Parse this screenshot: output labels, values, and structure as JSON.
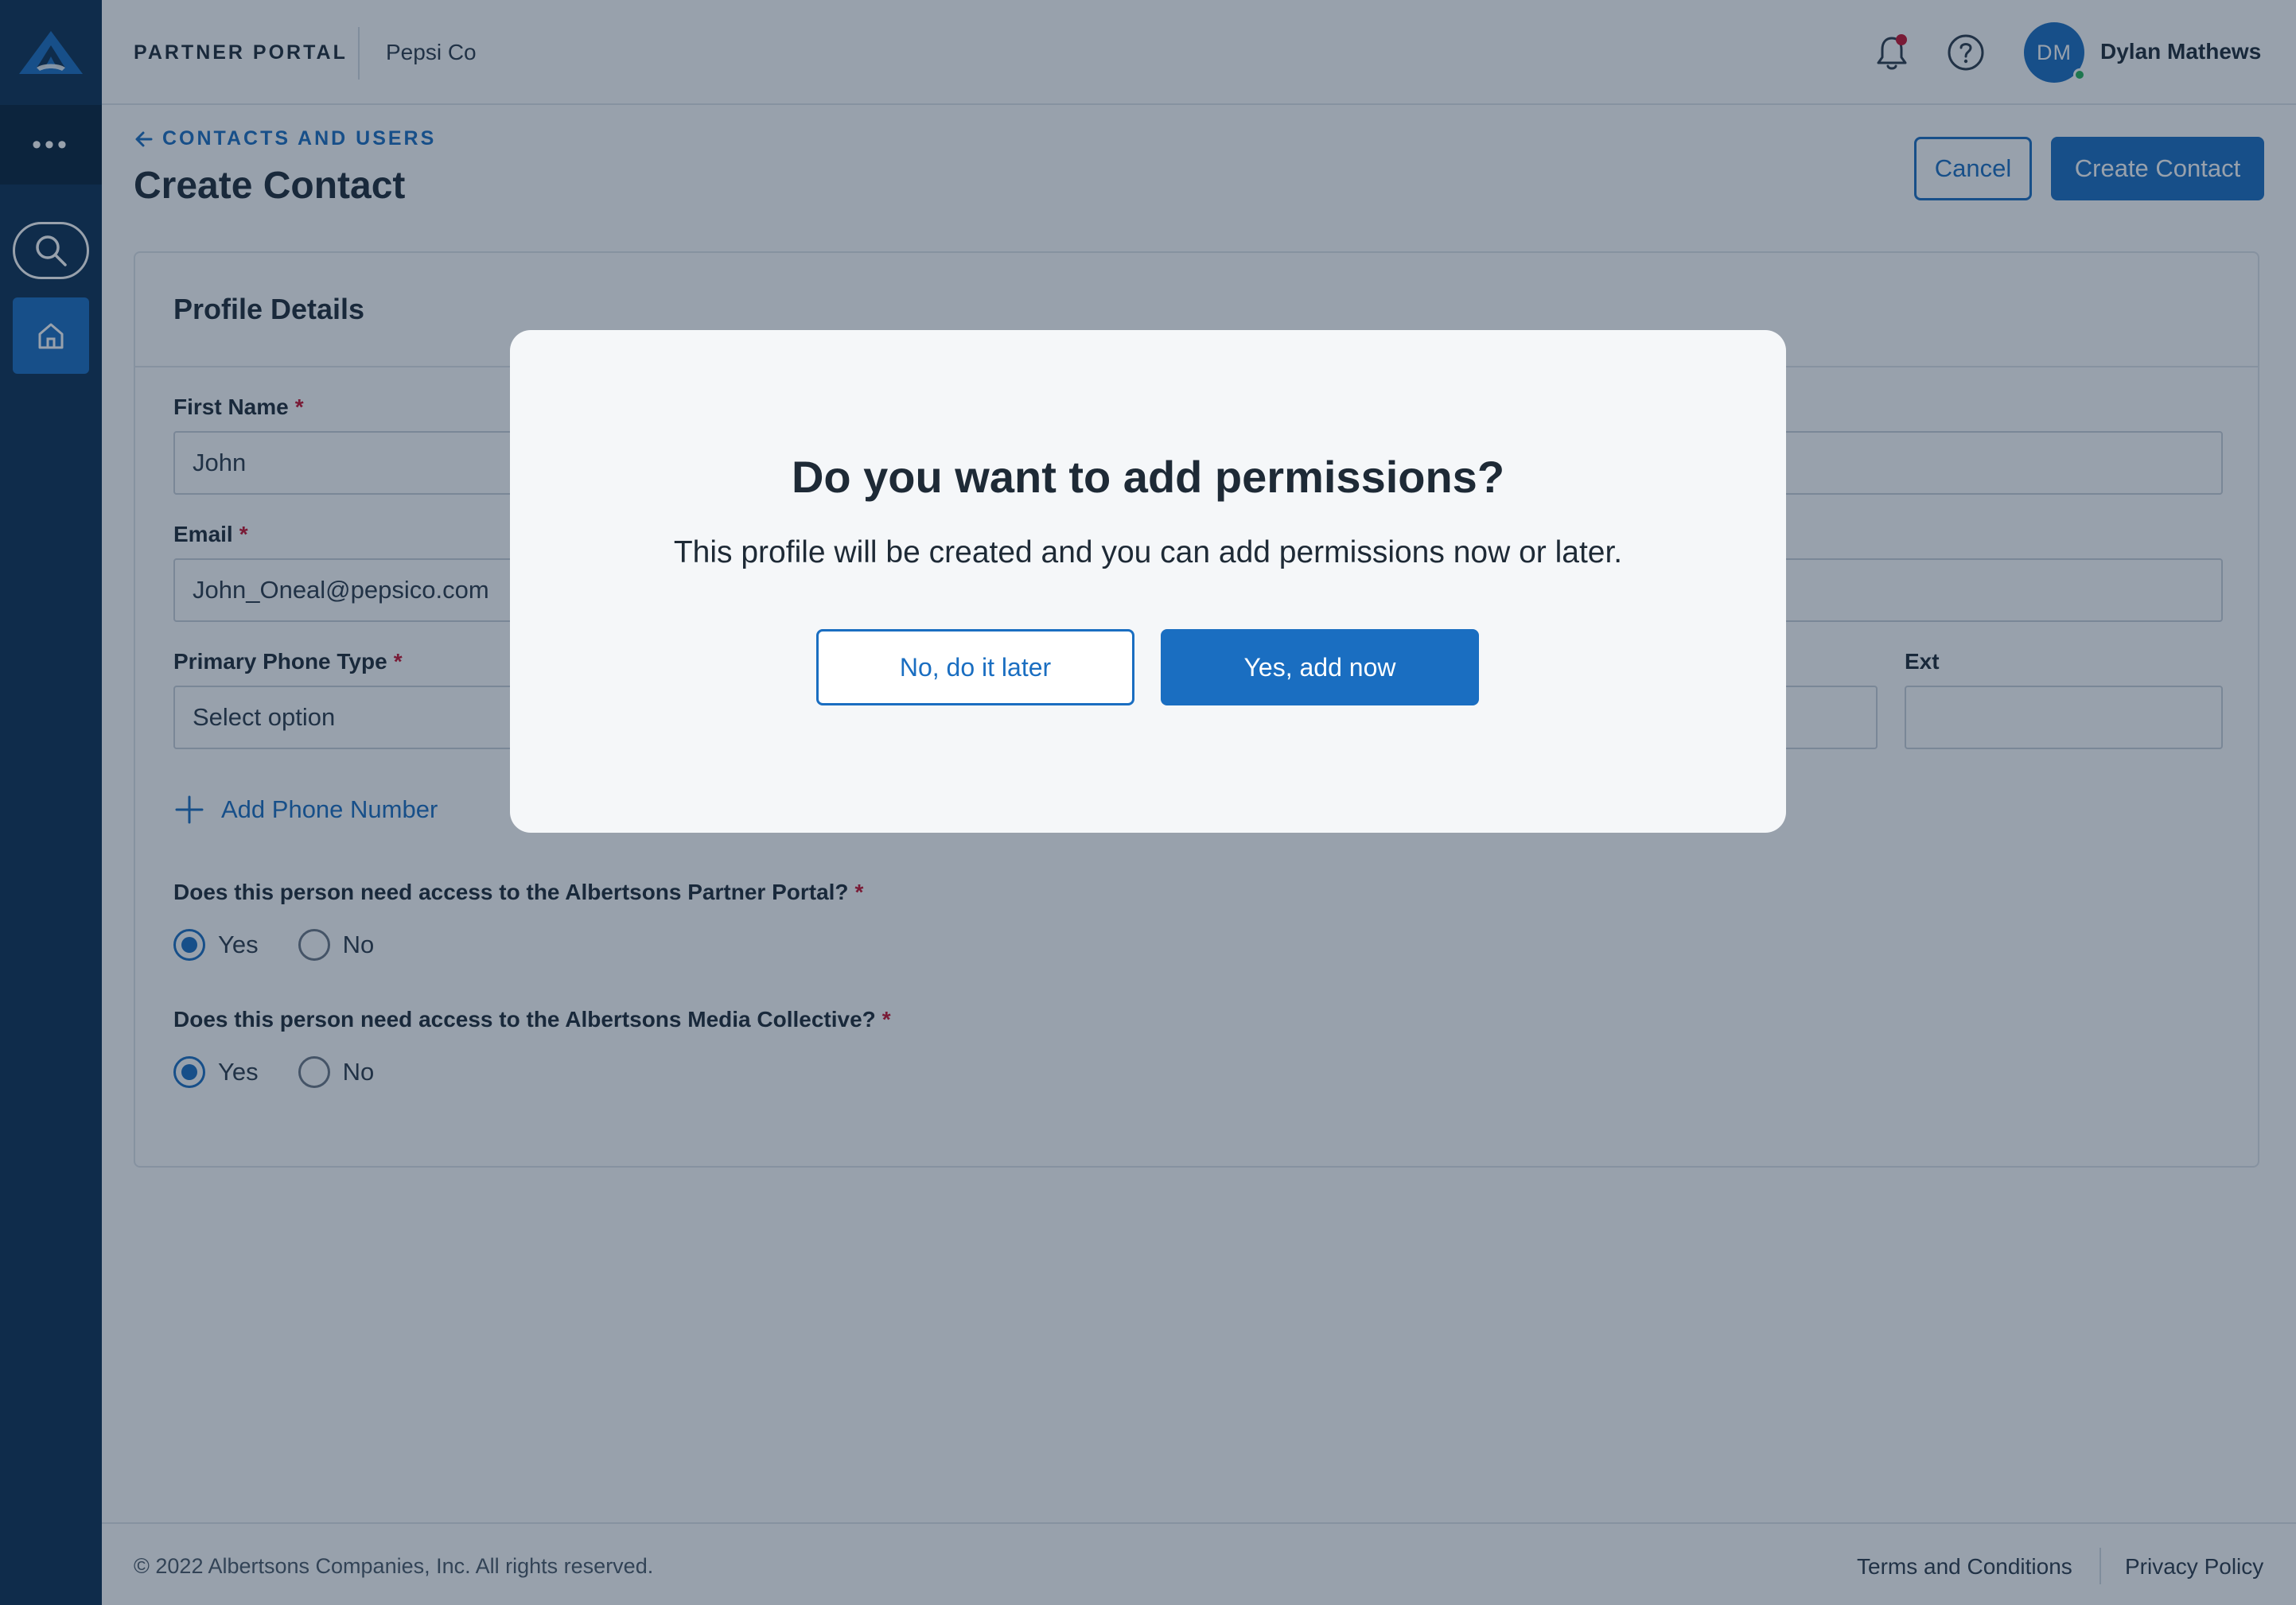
{
  "sidebar": {
    "logo_icon": "albertsons-logo-icon",
    "more_icon": "ellipsis-icon",
    "search_icon": "search-icon",
    "home_icon": "home-icon"
  },
  "header": {
    "portal_label": "PARTNER PORTAL",
    "company": "Pepsi Co",
    "notification_icon": "bell-icon",
    "help_icon": "help-circle-icon",
    "avatar_initials": "DM",
    "user_name": "Dylan Mathews"
  },
  "page": {
    "back_label": "CONTACTS AND USERS",
    "title": "Create Contact",
    "cancel_label": "Cancel",
    "create_label": "Create Contact"
  },
  "form": {
    "section_title": "Profile Details",
    "first_name_label": "First Name",
    "first_name_value": "John",
    "email_label": "Email",
    "email_value": "John_Oneal@pepsico.com",
    "phone_type_label": "Primary Phone Type",
    "phone_type_value": "Select option",
    "ext_label": "Ext",
    "ext_value": "",
    "required_mark": "*",
    "add_phone_label": "Add Phone Number",
    "q1": "Does this person need access to the Albertsons Partner Portal?",
    "q1_selected": "Yes",
    "q2": "Does this person need access to the Albertsons Media Collective?",
    "q2_selected": "Yes",
    "yes_label": "Yes",
    "no_label": "No"
  },
  "modal": {
    "title": "Do you want to add permissions?",
    "message": "This profile will be created and you can add permissions now or later.",
    "later_label": "No, do it later",
    "yes_label": "Yes, add now"
  },
  "footer": {
    "copyright": "© 2022 Albertsons Companies, Inc. All rights reserved.",
    "terms": "Terms and Conditions",
    "privacy": "Privacy Policy"
  },
  "colors": {
    "brand_navy": "#0b2f52",
    "accent_blue": "#1a6ec1",
    "required_red": "#c8102e",
    "notification_dot": "#c8102e",
    "presence_green": "#26b35a"
  }
}
